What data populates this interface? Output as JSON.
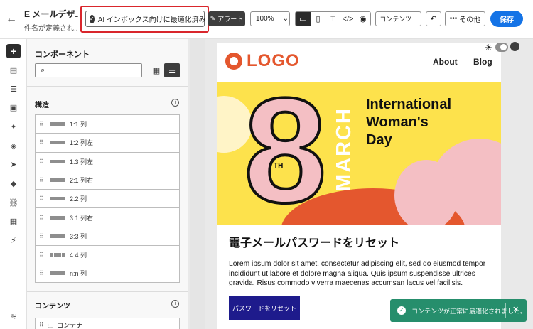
{
  "topbar": {
    "title": "E メールデザ...",
    "subtitle": "件名が定義され...",
    "ai_button": "AI インボックス向けに最適化済み",
    "alert_button": "アラート",
    "zoom": "100%",
    "content_button": "コンテンツ...",
    "other_button": "その他",
    "save_button": "保存"
  },
  "panel": {
    "title": "コンポーネント",
    "search_placeholder": "",
    "structure_label": "構造",
    "structure_items": [
      {
        "label": "1:1 列",
        "bars": 1
      },
      {
        "label": "1:2 列左",
        "bars": 2
      },
      {
        "label": "1:3 列左",
        "bars": 2
      },
      {
        "label": "2:1 列右",
        "bars": 2
      },
      {
        "label": "2:2 列",
        "bars": 2
      },
      {
        "label": "3:1 列右",
        "bars": 2
      },
      {
        "label": "3:3 列",
        "bars": 3
      },
      {
        "label": "4:4 列",
        "bars": 4
      },
      {
        "label": "n:n 列",
        "bars": 3
      }
    ],
    "content_label": "コンテンツ",
    "content_item": "コンテナ"
  },
  "email": {
    "logo_text": "LOGO",
    "nav": [
      "About",
      "Blog"
    ],
    "hero_title_lines": [
      "International",
      "Woman's",
      "Day"
    ],
    "hero_number": "8",
    "hero_suffix": "TH",
    "hero_month": "MARCH",
    "heading": "電子メールパスワードをリセット",
    "body": "Lorem ipsum dolor sit amet, consectetur adipiscing elit, sed do eiusmod tempor incididunt ut labore et dolore magna aliqua. Quis ipsum suspendisse ultrices gravida. Risus commodo viverra maecenas accumsan lacus vel facilisis.",
    "cta": "パスワードをリセット"
  },
  "toast": {
    "message": "コンテンツが正常に最適化されました。"
  },
  "colors": {
    "accent": "#1473e6",
    "logo": "#e4572e",
    "hero_bg": "#fde24c",
    "cta": "#1e1b8c",
    "toast": "#268e6c",
    "highlight": "#d9262c"
  }
}
